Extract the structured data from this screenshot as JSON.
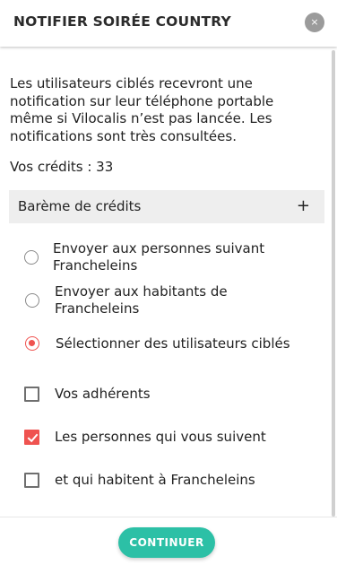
{
  "header": {
    "title": "NOTIFIER SOIRÉE COUNTRY",
    "close_icon": "×"
  },
  "intro_text": "Les utilisateurs ciblés recevront une notification sur leur téléphone portable même si Vilocalis n’est pas lancée. Les notifications sont très consultées.",
  "credits_text": "Vos crédits : 33",
  "bareme": {
    "label": "Barème de crédits",
    "icon": "+"
  },
  "options": {
    "radio1": "Envoyer aux personnes suivant Francheleins",
    "radio2": "Envoyer aux habitants de Francheleins",
    "radio3": "Sélectionner des utilisateurs ciblés",
    "selected": "radio3"
  },
  "checkboxes": {
    "c1": {
      "label": "Vos adhérents",
      "checked": false
    },
    "c2": {
      "label": "Les personnes qui vous suivent",
      "checked": true
    },
    "c3": {
      "label": "et qui habitent à Francheleins",
      "checked": false
    }
  },
  "colors": {
    "accent_red": "#ef5350",
    "button_teal": "#2cc0a6"
  },
  "footer": {
    "continue_label": "CONTINUER"
  }
}
